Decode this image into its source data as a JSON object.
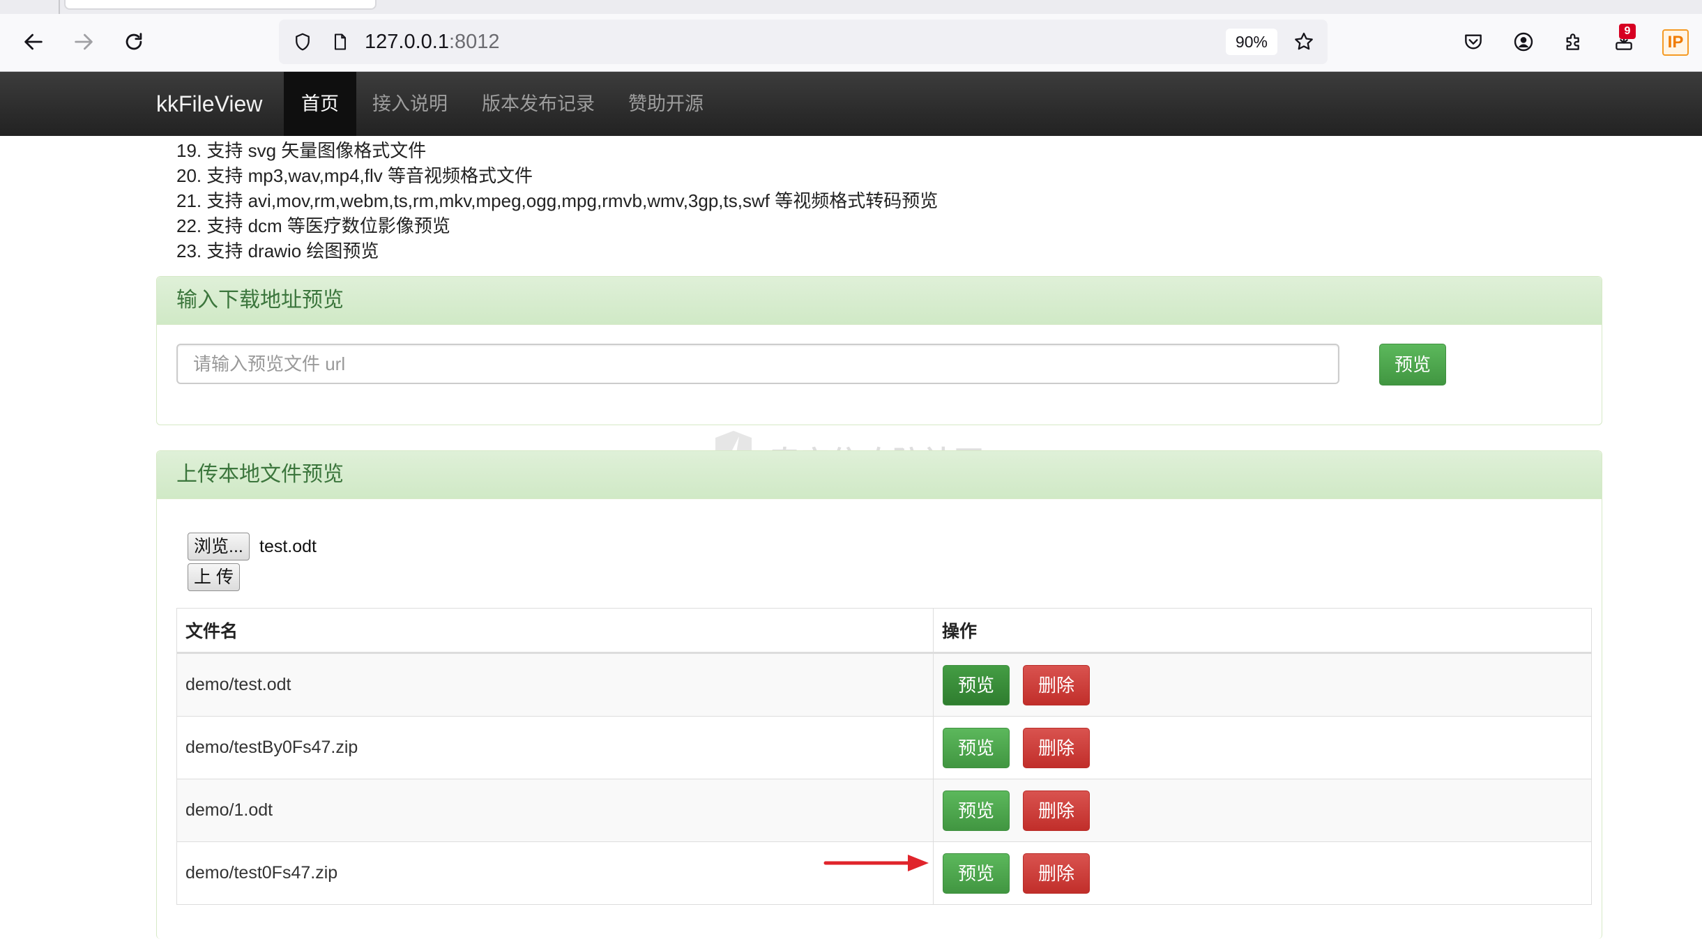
{
  "browser": {
    "url_host": "127.0.0.1",
    "url_port": ":8012",
    "zoom": "90%",
    "notification_count": "9",
    "ip_extension_label": "IP"
  },
  "navbar": {
    "brand": "kkFileView",
    "items": [
      {
        "label": "首页",
        "active": true
      },
      {
        "label": "接入说明",
        "active": false
      },
      {
        "label": "版本发布记录",
        "active": false
      },
      {
        "label": "赞助开源",
        "active": false
      }
    ]
  },
  "features": [
    "19. 支持 svg 矢量图像格式文件",
    "20. 支持 mp3,wav,mp4,flv 等音视频格式文件",
    "21. 支持 avi,mov,rm,webm,ts,rm,mkv,mpeg,ogg,mpg,rmvb,wmv,3gp,ts,swf 等视频格式转码预览",
    "22. 支持 dcm 等医疗数位影像预览",
    "23. 支持 drawio 绘图预览"
  ],
  "url_panel": {
    "title": "输入下载地址预览",
    "placeholder": "请输入预览文件 url",
    "preview_label": "预览"
  },
  "upload_panel": {
    "title": "上传本地文件预览",
    "browse_label": "浏览...",
    "selected_file": "test.odt",
    "upload_label": "上 传"
  },
  "table": {
    "col_filename": "文件名",
    "col_actions": "操作",
    "preview_label": "预览",
    "delete_label": "删除",
    "rows": [
      {
        "name": "demo/test.odt"
      },
      {
        "name": "demo/testBy0Fs47.zip"
      },
      {
        "name": "demo/1.odt"
      },
      {
        "name": "demo/test0Fs47.zip"
      }
    ]
  },
  "watermark": "奇安信攻防社区",
  "colors": {
    "success": "#5cb85c",
    "danger": "#d9534f",
    "panel_heading_text": "#3c763d",
    "annotation_arrow": "#e0242b"
  }
}
